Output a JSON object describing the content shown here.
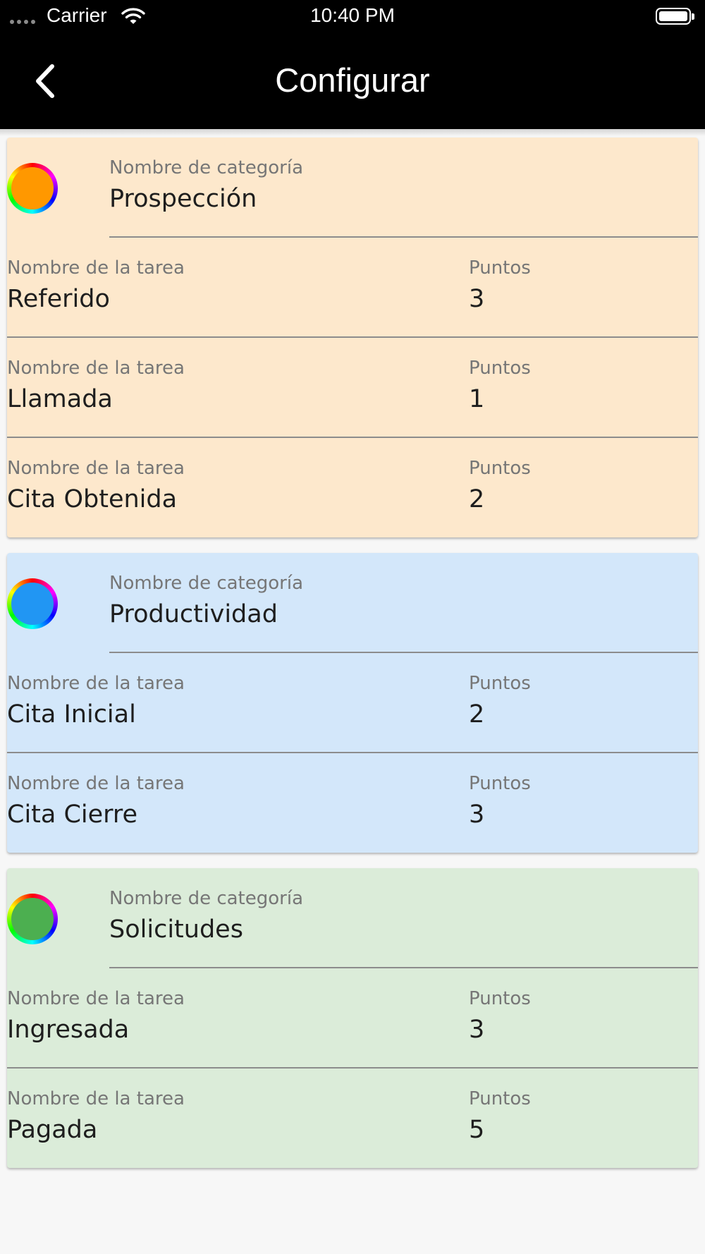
{
  "status_bar": {
    "carrier": "Carrier",
    "time": "10:40 PM"
  },
  "app_bar": {
    "title": "Configurar",
    "back_icon": "chevron-left-icon"
  },
  "labels": {
    "category_label": "Nombre de categoría",
    "task_label": "Nombre de la tarea",
    "points_label": "Puntos"
  },
  "categories": [
    {
      "name": "Prospección",
      "background": "#fde8cc",
      "color": "#ff9800",
      "tasks": [
        {
          "name": "Referido",
          "points": "3"
        },
        {
          "name": "Llamada",
          "points": "1"
        },
        {
          "name": "Cita Obtenida",
          "points": "2"
        }
      ]
    },
    {
      "name": "Productividad",
      "background": "#d3e7fa",
      "color": "#2196f3",
      "tasks": [
        {
          "name": "Cita Inicial",
          "points": "2"
        },
        {
          "name": "Cita Cierre",
          "points": "3"
        }
      ]
    },
    {
      "name": "Solicitudes",
      "background": "#dbecd9",
      "color": "#4caf50",
      "tasks": [
        {
          "name": "Ingresada",
          "points": "3"
        },
        {
          "name": "Pagada",
          "points": "5"
        }
      ]
    }
  ]
}
